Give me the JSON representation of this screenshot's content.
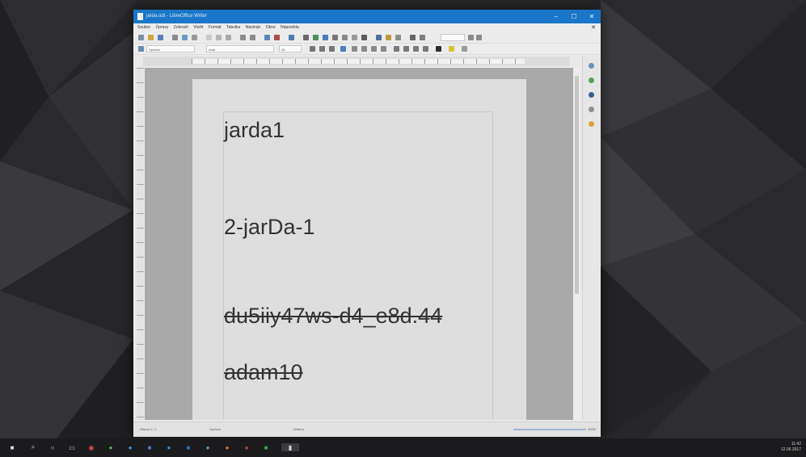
{
  "window": {
    "title": "jarda.odt - LibreOffice Writer"
  },
  "menu": {
    "items": [
      "Soubor",
      "Úpravy",
      "Zobrazit",
      "Vložit",
      "Formát",
      "Tabulka",
      "Nástroje",
      "Okno",
      "Nápověda"
    ]
  },
  "toolbar": {
    "style_value": "Výchozí",
    "font_value": "Arial",
    "size_value": "28"
  },
  "document": {
    "lines": [
      {
        "text": "jarda1",
        "struck": false
      },
      {
        "text": "2-jarDa-1",
        "struck": false
      },
      {
        "text": "du5iiy47ws-d4_e8d.44",
        "struck": true
      },
      {
        "text": "adam10",
        "struck": true
      }
    ]
  },
  "status": {
    "page": "Strana 1 / 1",
    "style": "Výchozí",
    "language": "čeština",
    "zoom": "100%"
  },
  "taskbar": {
    "clock_time": "11:42",
    "clock_date": "12.06.2017"
  },
  "colors": {
    "titlebar": "#1976c8",
    "taskbar": "#1b1b1d"
  }
}
